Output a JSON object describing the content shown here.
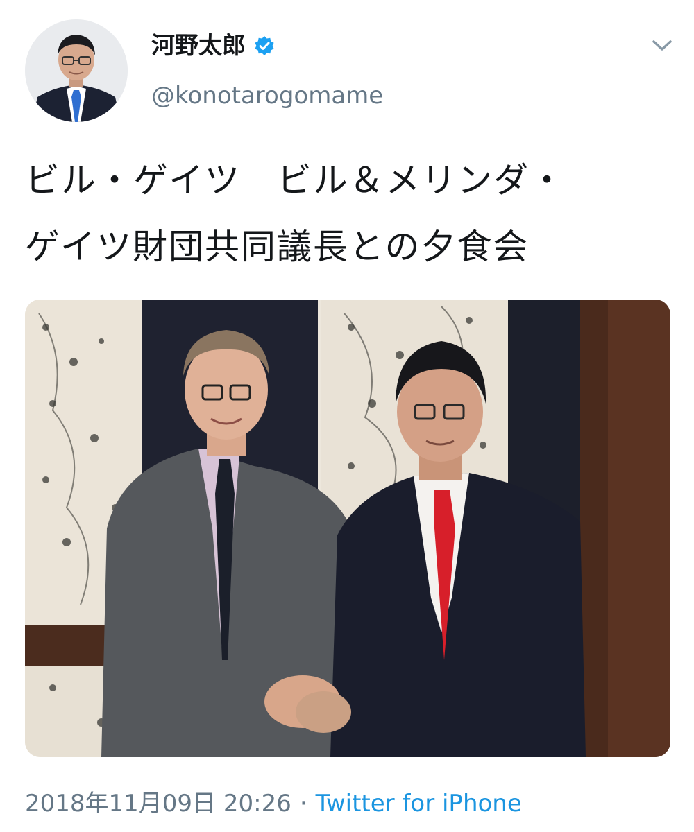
{
  "user": {
    "display_name": "河野太郎",
    "handle": "@konotarogomame",
    "verified": true,
    "avatar_icon": "profile-photo"
  },
  "tweet": {
    "text_line1": "ビル・ゲイツ　ビル＆メリンダ・",
    "text_line2": "ゲイツ財団共同議長との夕食会",
    "timestamp": "2018年11月09日 20:26",
    "separator": "·",
    "source": "Twitter for iPhone"
  },
  "icons": {
    "verified": "verified-badge-icon",
    "menu": "chevron-down-icon"
  },
  "colors": {
    "link": "#1b95e0",
    "secondary_text": "#657786",
    "verified": "#1da1f2",
    "primary_text": "#14171a"
  }
}
